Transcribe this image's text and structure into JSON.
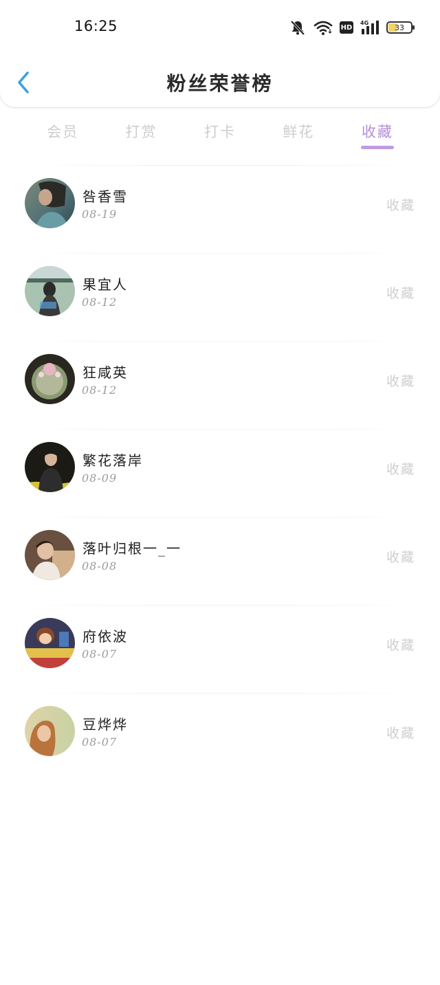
{
  "status_bar": {
    "time": "16:25",
    "hd_label": "HD",
    "network_label": "4G",
    "battery_level": "33"
  },
  "header": {
    "title": "粉丝荣誉榜"
  },
  "tabs": [
    {
      "label": "会员",
      "active": false
    },
    {
      "label": "打赏",
      "active": false
    },
    {
      "label": "打卡",
      "active": false
    },
    {
      "label": "鲜花",
      "active": false
    },
    {
      "label": "收藏",
      "active": true
    }
  ],
  "colors": {
    "accent": "#c09ae2",
    "back_arrow": "#3aa0e6",
    "muted_text": "#cfcfcf"
  },
  "fans": [
    {
      "name": "咎香雪",
      "date": "08-19",
      "action": "收藏"
    },
    {
      "name": "果宜人",
      "date": "08-12",
      "action": "收藏"
    },
    {
      "name": "狂咸英",
      "date": "08-12",
      "action": "收藏"
    },
    {
      "name": "繁花落岸",
      "date": "08-09",
      "action": "收藏"
    },
    {
      "name": "落叶归根一_一",
      "date": "08-08",
      "action": "收藏"
    },
    {
      "name": "府依波",
      "date": "08-07",
      "action": "收藏"
    },
    {
      "name": "豆烨烨",
      "date": "08-07",
      "action": "收藏"
    }
  ]
}
